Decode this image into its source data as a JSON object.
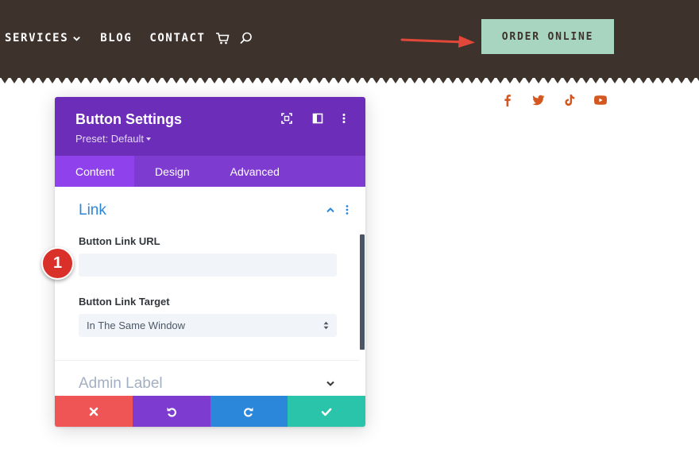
{
  "header": {
    "nav": {
      "services": "SERVICES",
      "blog": "BLOG",
      "contact": "CONTACT"
    },
    "order_button": "ORDER ONLINE",
    "icons": [
      "chevron-down-icon",
      "cart-icon",
      "search-icon"
    ],
    "background": "#3d322c",
    "accent": "#a8d5bf"
  },
  "socials": [
    "facebook-icon",
    "twitter-icon",
    "tiktok-icon",
    "youtube-icon"
  ],
  "modal": {
    "title": "Button Settings",
    "preset": "Preset: Default",
    "tabs": [
      "Content",
      "Design",
      "Advanced"
    ],
    "active_tab": "Content",
    "section": {
      "title": "Link",
      "fields": {
        "url_label": "Button Link URL",
        "url_value": "",
        "target_label": "Button Link Target",
        "target_value": "In The Same Window"
      }
    },
    "admin_label": "Admin Label",
    "footer": [
      "close-icon",
      "undo-icon",
      "redo-icon",
      "check-icon"
    ],
    "colors": {
      "header": "#6c2eb9",
      "tabs": "#7e3bd0",
      "link": "#2b87da",
      "cancel": "#ef5555",
      "save": "#29c4a9"
    }
  },
  "annotation": {
    "step": "1"
  }
}
